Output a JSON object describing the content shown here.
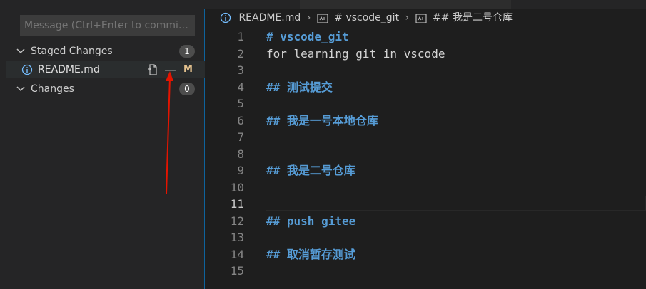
{
  "scm": {
    "commit_placeholder": "Message (Ctrl+Enter to commit…",
    "staged": {
      "label": "Staged Changes",
      "count": "1",
      "files": [
        {
          "name": "README.md",
          "status": "M"
        }
      ]
    },
    "changes": {
      "label": "Changes",
      "count": "0"
    }
  },
  "breadcrumb": {
    "file": "README.md",
    "symbol1": "# vscode_git",
    "symbol2": "## 我是二号仓库"
  },
  "editor": {
    "lines": [
      {
        "num": "1",
        "text": "# vscode_git",
        "kind": "heading"
      },
      {
        "num": "2",
        "text": "for learning git in vscode",
        "kind": "plain"
      },
      {
        "num": "3",
        "text": "",
        "kind": "plain"
      },
      {
        "num": "4",
        "text": "## 测试提交",
        "kind": "heading"
      },
      {
        "num": "5",
        "text": "",
        "kind": "plain"
      },
      {
        "num": "6",
        "text": "## 我是一号本地仓库",
        "kind": "heading"
      },
      {
        "num": "7",
        "text": "",
        "kind": "plain"
      },
      {
        "num": "8",
        "text": "",
        "kind": "plain"
      },
      {
        "num": "9",
        "text": "## 我是二号仓库",
        "kind": "heading"
      },
      {
        "num": "10",
        "text": "",
        "kind": "plain"
      },
      {
        "num": "11",
        "text": "",
        "kind": "plain",
        "current": true
      },
      {
        "num": "12",
        "text": "## push gitee",
        "kind": "heading"
      },
      {
        "num": "13",
        "text": "",
        "kind": "plain"
      },
      {
        "num": "14",
        "text": "## 取消暂存测试",
        "kind": "heading"
      },
      {
        "num": "15",
        "text": "",
        "kind": "plain"
      }
    ]
  },
  "colors": {
    "heading": "#569cd6",
    "modified": "#e2c08d",
    "focus": "#0e639c",
    "annotation_arrow": "#e51400"
  }
}
